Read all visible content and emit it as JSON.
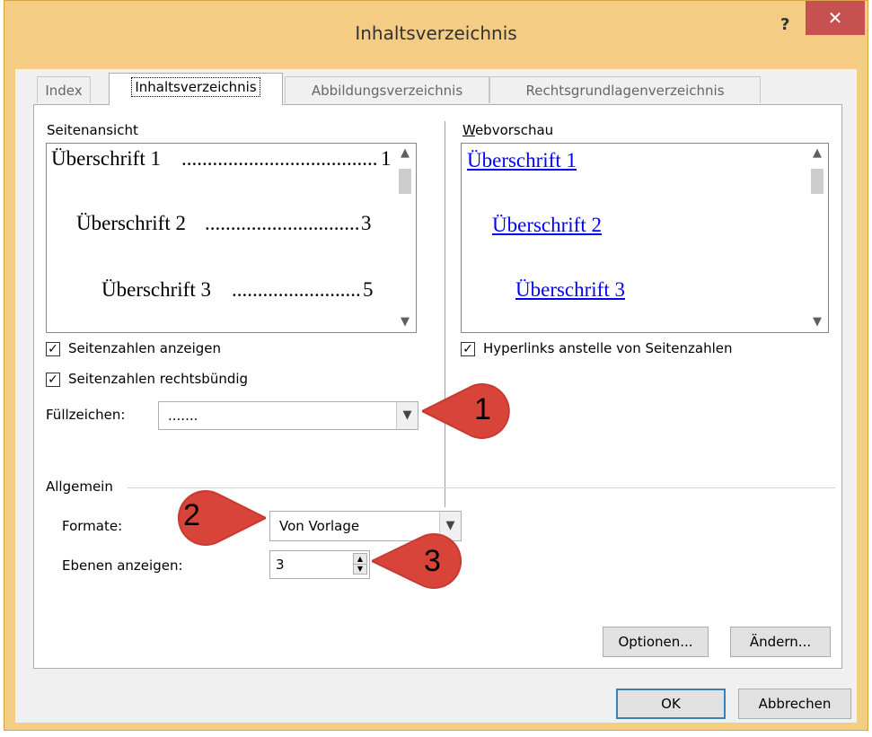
{
  "dialog": {
    "title": "Inhaltsverzeichnis",
    "help_label": "?",
    "close_label": "✕"
  },
  "tabs": [
    {
      "label": "Index",
      "active": false
    },
    {
      "label": "Inhaltsverzeichnis",
      "active": true
    },
    {
      "label": "Abbildungsverzeichnis",
      "active": false
    },
    {
      "label": "Rechtsgrundlagenverzeichnis",
      "active": false
    }
  ],
  "print_preview": {
    "label": "Seitenansicht",
    "entries": [
      {
        "text": "Überschrift 1",
        "dots": "..............................................",
        "page": "1"
      },
      {
        "text": "Überschrift 2",
        "dots": "..............................................",
        "page": "3"
      },
      {
        "text": "Überschrift 3",
        "dots": "..............................................",
        "page": "5"
      }
    ]
  },
  "web_preview": {
    "label": "Webvorschau",
    "entries": [
      "Überschrift 1",
      "Überschrift 2",
      "Überschrift 3"
    ]
  },
  "options": {
    "show_page_numbers": {
      "label": "Seitenzahlen anzeigen",
      "checked": true
    },
    "right_align": {
      "label": "Seitenzahlen rechtsbündig",
      "checked": true
    },
    "hyperlinks": {
      "label": "Hyperlinks anstelle von Seitenzahlen",
      "checked": true
    },
    "tab_leader_label": "Füllzeichen:",
    "tab_leader_value": "......."
  },
  "general": {
    "label": "Allgemein",
    "formats_label": "Formate:",
    "formats_value": "Von Vorlage",
    "levels_label": "Ebenen anzeigen:",
    "levels_value": "3"
  },
  "buttons": {
    "options": "Optionen...",
    "modify": "Ändern...",
    "ok": "OK",
    "cancel": "Abbrechen"
  },
  "callouts": [
    "1",
    "2",
    "3"
  ],
  "colors": {
    "titlebar": "#f5cc84",
    "close": "#c75050",
    "link": "#0000ff",
    "callout": "#d9443a"
  },
  "icons": {
    "scroll_up": "▲",
    "scroll_down": "▼",
    "dropdown": "▼",
    "check": "✓"
  }
}
